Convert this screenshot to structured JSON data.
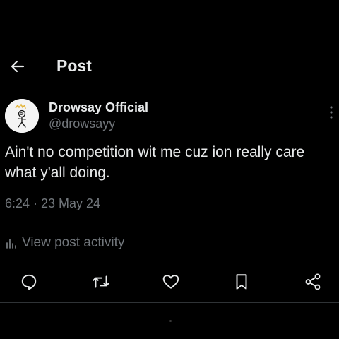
{
  "header": {
    "title": "Post",
    "back_icon": "arrow-left-icon"
  },
  "author": {
    "display_name": "Drowsay Official",
    "handle": "@drowsayy",
    "avatar_icon": "stick-figure-avatar"
  },
  "post": {
    "text": "Ain't no competition wit me cuz ion really care what y'all doing.",
    "timestamp": "6:24 · 23 May 24"
  },
  "activity": {
    "label": "View post activity",
    "icon": "bar-chart-icon"
  },
  "actions": [
    "reply-icon",
    "repost-icon",
    "like-icon",
    "bookmark-icon",
    "share-icon"
  ],
  "colors": {
    "background": "#000000",
    "primary_text": "#e7e9ea",
    "secondary_text": "#71767b",
    "divider": "#2f3336"
  }
}
